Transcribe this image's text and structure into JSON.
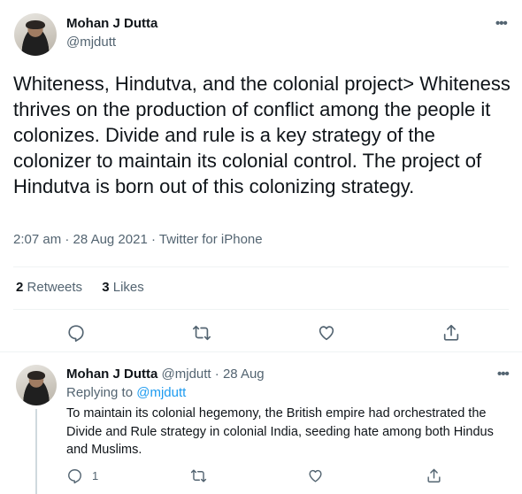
{
  "main_tweet": {
    "author_name": "Mohan J Dutta",
    "author_handle": "@mjdutt",
    "more_label": "•••",
    "text": "Whiteness, Hindutva, and the colonial project> Whiteness thrives on the production of conflict among the people it colonizes. Divide and rule is a key strategy of the colonizer to maintain its colonial control. The project of Hindutva is born out of this colonizing strategy.",
    "time": "2:07 am",
    "date": "28 Aug 2021",
    "source": "Twitter for iPhone",
    "meta_separator": "·",
    "retweets_count": "2",
    "retweets_label": "Retweets",
    "likes_count": "3",
    "likes_label": "Likes",
    "actions": [
      "reply-icon",
      "retweet-icon",
      "like-icon",
      "share-icon"
    ]
  },
  "reply_tweet": {
    "author_name": "Mohan J Dutta",
    "author_handle": "@mjdutt",
    "separator": "·",
    "date": "28 Aug",
    "more_label": "•••",
    "replying_to_label": "Replying to",
    "replying_to_handle": "@mjdutt",
    "text": "To maintain its colonial hegemony, the British empire had orchestrated the Divide and Rule strategy in colonial India, seeding hate among both Hindus and Muslims.",
    "reply_count": "1",
    "actions": [
      "reply-icon",
      "retweet-icon",
      "like-icon",
      "share-icon"
    ]
  },
  "colors": {
    "text_primary": "#0f1419",
    "text_secondary": "#536471",
    "link": "#1d9bf0",
    "divider": "#eff3f4"
  }
}
